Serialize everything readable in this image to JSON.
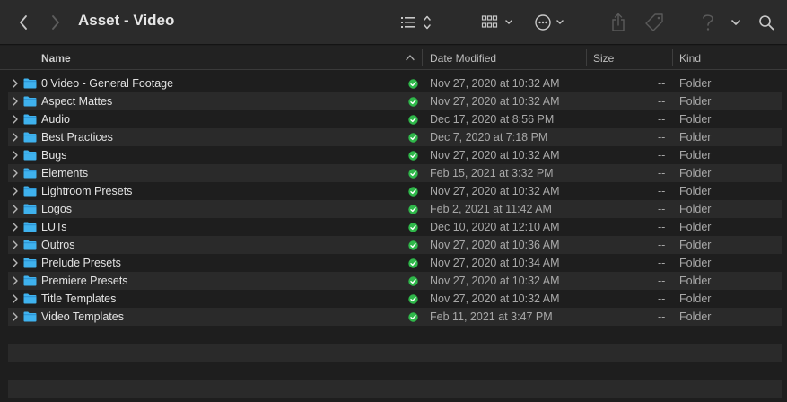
{
  "window": {
    "title": "Asset - Video"
  },
  "toolbar": {
    "back_icon": "chevron-left-icon",
    "forward_icon": "chevron-right-icon",
    "view_icon": "list-view-icon",
    "group_icon": "grid-group-icon",
    "action_icon": "ellipsis-circle-icon",
    "share_icon": "share-icon",
    "tag_icon": "tag-icon",
    "help_icon": "question-icon",
    "more_icon": "chevron-down-icon",
    "search_icon": "search-icon"
  },
  "columns": {
    "name": "Name",
    "date": "Date Modified",
    "size": "Size",
    "kind": "Kind"
  },
  "colors": {
    "folder": "#3fb2ee",
    "sync_ok": "#2fb84a",
    "background": "#1e1e1e",
    "alt_row": "#2a2a2a"
  },
  "files": [
    {
      "name": "0 Video - General Footage",
      "date": "Nov 27, 2020 at 10:32 AM",
      "size": "--",
      "kind": "Folder"
    },
    {
      "name": "Aspect Mattes",
      "date": "Nov 27, 2020 at 10:32 AM",
      "size": "--",
      "kind": "Folder"
    },
    {
      "name": "Audio",
      "date": "Dec 17, 2020 at 8:56 PM",
      "size": "--",
      "kind": "Folder"
    },
    {
      "name": "Best Practices",
      "date": "Dec 7, 2020 at 7:18 PM",
      "size": "--",
      "kind": "Folder"
    },
    {
      "name": "Bugs",
      "date": "Nov 27, 2020 at 10:32 AM",
      "size": "--",
      "kind": "Folder"
    },
    {
      "name": "Elements",
      "date": "Feb 15, 2021 at 3:32 PM",
      "size": "--",
      "kind": "Folder"
    },
    {
      "name": "Lightroom Presets",
      "date": "Nov 27, 2020 at 10:32 AM",
      "size": "--",
      "kind": "Folder"
    },
    {
      "name": "Logos",
      "date": "Feb 2, 2021 at 11:42 AM",
      "size": "--",
      "kind": "Folder"
    },
    {
      "name": "LUTs",
      "date": "Dec 10, 2020 at 12:10 AM",
      "size": "--",
      "kind": "Folder"
    },
    {
      "name": "Outros",
      "date": "Nov 27, 2020 at 10:36 AM",
      "size": "--",
      "kind": "Folder"
    },
    {
      "name": "Prelude Presets",
      "date": "Nov 27, 2020 at 10:34 AM",
      "size": "--",
      "kind": "Folder"
    },
    {
      "name": "Premiere Presets",
      "date": "Nov 27, 2020 at 10:32 AM",
      "size": "--",
      "kind": "Folder"
    },
    {
      "name": "Title Templates",
      "date": "Nov 27, 2020 at 10:32 AM",
      "size": "--",
      "kind": "Folder"
    },
    {
      "name": "Video Templates",
      "date": "Feb 11, 2021 at 3:47 PM",
      "size": "--",
      "kind": "Folder"
    }
  ]
}
